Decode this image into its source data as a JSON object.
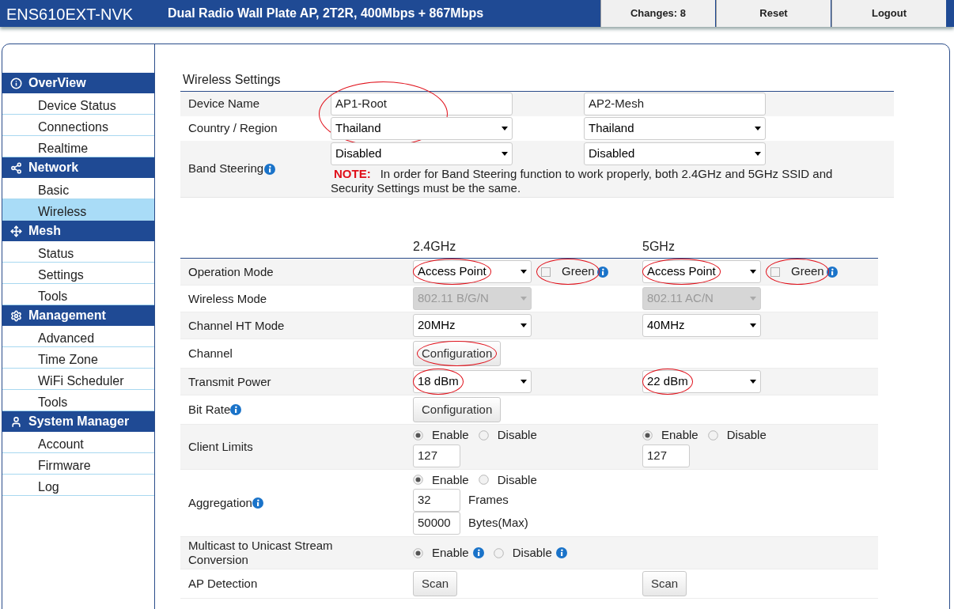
{
  "header": {
    "model": "ENS610EXT-NVK",
    "description": "Dual Radio Wall Plate AP, 2T2R, 400Mbps + 867Mbps",
    "buttons": [
      "Changes: 8",
      "Reset",
      "Logout"
    ]
  },
  "sidebar": [
    {
      "heading": "OverView",
      "items": [
        {
          "label": "Device Status",
          "selected": false
        },
        {
          "label": "Connections",
          "selected": false
        },
        {
          "label": "Realtime",
          "selected": false
        }
      ]
    },
    {
      "heading": "Network",
      "items": [
        {
          "label": "Basic",
          "selected": false
        },
        {
          "label": "Wireless",
          "selected": true
        }
      ]
    },
    {
      "heading": "Mesh",
      "items": [
        {
          "label": "Status",
          "selected": false
        },
        {
          "label": "Settings",
          "selected": false
        },
        {
          "label": "Tools",
          "selected": false
        }
      ]
    },
    {
      "heading": "Management",
      "items": [
        {
          "label": "Advanced",
          "selected": false
        },
        {
          "label": "Time Zone",
          "selected": false
        },
        {
          "label": "WiFi Scheduler",
          "selected": false
        },
        {
          "label": "Tools",
          "selected": false
        }
      ]
    },
    {
      "heading": "System Manager",
      "items": [
        {
          "label": "Account",
          "selected": false
        },
        {
          "label": "Firmware",
          "selected": false
        },
        {
          "label": "Log",
          "selected": false
        }
      ]
    }
  ],
  "general": {
    "title": "Wireless Settings",
    "rows": [
      {
        "label": "Device Name",
        "info": false,
        "fields": [
          {
            "kind": "input",
            "value": "AP1-Root",
            "circled": true
          },
          {
            "kind": "input",
            "value": "AP2-Mesh",
            "circled": false
          }
        ]
      },
      {
        "label": "Country / Region",
        "info": false,
        "fields": [
          {
            "kind": "select",
            "value": "Thailand",
            "circled": false
          },
          {
            "kind": "select",
            "value": "Thailand",
            "circled": false
          }
        ]
      },
      {
        "label": "Band Steering",
        "info": true,
        "fields": [
          {
            "kind": "select",
            "value": "Disabled",
            "circled": false
          },
          {
            "kind": "select",
            "value": "Disabled",
            "circled": false
          }
        ],
        "note": {
          "label": "NOTE:",
          "text": "In order for Band Steering function to work properly, both 2.4GHz and 5GHz SSID and Security Settings must be the same."
        }
      }
    ]
  },
  "radio": {
    "columns": [
      "2.4GHz",
      "5GHz"
    ],
    "rows": [
      {
        "label": "Operation Mode",
        "info": false,
        "cells": [
          [
            [
              {
                "kind": "select",
                "value": "Access Point",
                "circled": true,
                "disabled": false
              },
              {
                "kind": "checkbox",
                "label": "Green",
                "checked": false,
                "circled": true,
                "info": true
              }
            ]
          ],
          [
            [
              {
                "kind": "select",
                "value": "Access Point",
                "circled": true,
                "disabled": false
              },
              {
                "kind": "checkbox",
                "label": "Green",
                "checked": false,
                "circled": true,
                "info": true
              }
            ]
          ]
        ]
      },
      {
        "label": "Wireless Mode",
        "info": false,
        "cells": [
          [
            [
              {
                "kind": "select",
                "value": "802.11 B/G/N",
                "circled": false,
                "disabled": true
              }
            ]
          ],
          [
            [
              {
                "kind": "select",
                "value": "802.11 AC/N",
                "circled": false,
                "disabled": true
              }
            ]
          ]
        ]
      },
      {
        "label": "Channel HT Mode",
        "info": false,
        "cells": [
          [
            [
              {
                "kind": "select",
                "value": "20MHz",
                "circled": false,
                "disabled": false
              }
            ]
          ],
          [
            [
              {
                "kind": "select",
                "value": "40MHz",
                "circled": false,
                "disabled": false
              }
            ]
          ]
        ]
      },
      {
        "label": "Channel",
        "info": false,
        "cells": [
          [
            [
              {
                "kind": "button",
                "label": "Configuration",
                "circled": true
              }
            ]
          ]
        ]
      },
      {
        "label": "Transmit Power",
        "info": false,
        "cells": [
          [
            [
              {
                "kind": "select",
                "value": "18 dBm",
                "circled": true,
                "disabled": false
              }
            ]
          ],
          [
            [
              {
                "kind": "select",
                "value": "22 dBm",
                "circled": true,
                "disabled": false
              }
            ]
          ]
        ]
      },
      {
        "label": "Bit Rate",
        "info": true,
        "cells": [
          [
            [
              {
                "kind": "button",
                "label": "Configuration",
                "circled": false
              }
            ]
          ]
        ]
      },
      {
        "label": "Client Limits",
        "info": false,
        "cells": [
          [
            [
              {
                "kind": "radio",
                "options": [
                  {
                    "label": "Enable",
                    "selected": true,
                    "info": false
                  },
                  {
                    "label": "Disable",
                    "selected": false,
                    "info": false
                  }
                ]
              }
            ],
            [
              {
                "kind": "input",
                "value": "127"
              }
            ]
          ],
          [
            [
              {
                "kind": "radio",
                "options": [
                  {
                    "label": "Enable",
                    "selected": true,
                    "info": false
                  },
                  {
                    "label": "Disable",
                    "selected": false,
                    "info": false
                  }
                ]
              }
            ],
            [
              {
                "kind": "input",
                "value": "127"
              }
            ]
          ]
        ]
      },
      {
        "label": "Aggregation",
        "info": true,
        "cells": [
          [
            [
              {
                "kind": "radio",
                "options": [
                  {
                    "label": "Enable",
                    "selected": true,
                    "info": false
                  },
                  {
                    "label": "Disable",
                    "selected": false,
                    "info": false
                  }
                ]
              }
            ],
            [
              {
                "kind": "input",
                "value": "32"
              },
              {
                "kind": "text",
                "label": "Frames"
              }
            ],
            [
              {
                "kind": "input",
                "value": "50000"
              },
              {
                "kind": "text",
                "label": "Bytes(Max)"
              }
            ]
          ]
        ]
      },
      {
        "label": "Multicast to Unicast Stream Conversion",
        "info": false,
        "cells": [
          [
            [
              {
                "kind": "radio",
                "options": [
                  {
                    "label": "Enable",
                    "selected": true,
                    "info": true
                  },
                  {
                    "label": "Disable",
                    "selected": false,
                    "info": true
                  }
                ]
              }
            ]
          ]
        ]
      },
      {
        "label": "AP Detection",
        "info": false,
        "cells": [
          [
            [
              {
                "kind": "button",
                "label": "Scan",
                "circled": false
              }
            ]
          ],
          [
            [
              {
                "kind": "button",
                "label": "Scan",
                "circled": false
              }
            ]
          ]
        ]
      }
    ]
  }
}
